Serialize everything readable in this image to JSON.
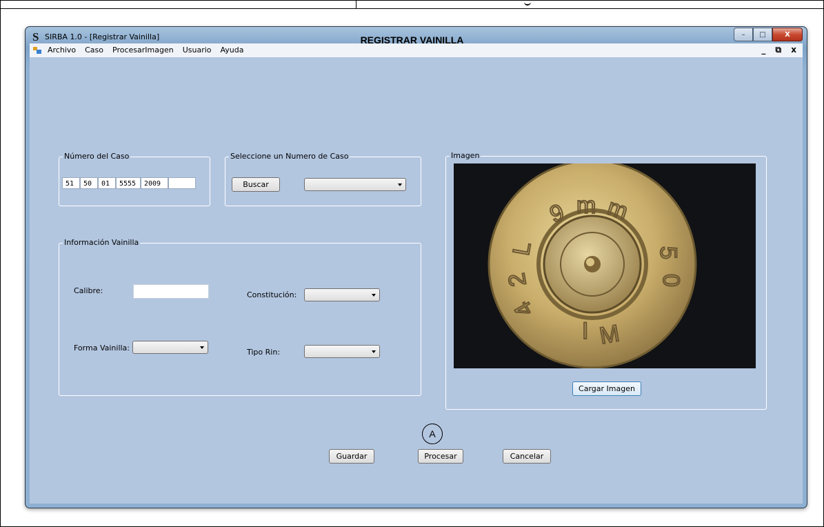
{
  "window": {
    "title": "SIRBA 1.0 - [Registrar Vainilla]",
    "controls": {
      "minimize": "–",
      "maximize": "□",
      "close": "X"
    }
  },
  "menu": [
    "Archivo",
    "Caso",
    "ProcesarImagen",
    "Usuario",
    "Ayuda"
  ],
  "mdi_controls": "_ ⧉ x",
  "form_title": "REGISTRAR VAINILLA",
  "numero_caso": {
    "legend": "Número del Caso",
    "fields": [
      "51",
      "50",
      "01",
      "5555",
      "2009",
      ""
    ]
  },
  "seleccione": {
    "legend": "Seleccione un Numero de  Caso",
    "buscar_label": "Buscar",
    "combo_value": ""
  },
  "info": {
    "legend": "Información Vainilla",
    "calibre_label": "Calibre:",
    "calibre_value": "",
    "constitucion_label": "Constitución:",
    "forma_label": "Forma Vainilla:",
    "tipo_rin_label": "Tipo Rin:"
  },
  "imagen": {
    "legend": "Imagen",
    "cargar_label": "Cargar Imagen",
    "headstamp": [
      "9",
      "m",
      "m",
      "5",
      "0",
      "I",
      "M",
      "4",
      "2",
      "L"
    ]
  },
  "annotation": "A",
  "buttons": {
    "guardar": "Guardar",
    "procesar": "Procesar",
    "cancelar": "Cancelar"
  }
}
